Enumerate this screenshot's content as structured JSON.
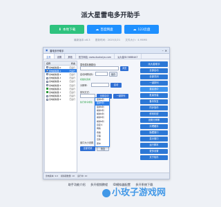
{
  "header": {
    "title": "派大星雷电多开助手"
  },
  "buttons": [
    {
      "label": "本地下载",
      "color": "#2ec27e"
    },
    {
      "label": "百度网盘",
      "color": "#1e90ff"
    },
    {
      "label": "123云盘",
      "color": "#1e90ff"
    }
  ],
  "meta": {
    "version": "最新版本:v8.3",
    "updated": "更新时间：2025/3/21",
    "size": "文件大小：4.95MB"
  },
  "window": {
    "title": "雷电多开助手",
    "tabs": [
      "主页",
      "设置",
      "其他",
      "官方网站: www.duokaiya.com",
      "派大星ID:56B84A7"
    ],
    "list_header": [
      "名称",
      "状态"
    ],
    "list": [
      {
        "name": "雷电模拟器-0",
        "val": "已运行"
      },
      {
        "name": "雷电模拟器-1",
        "val": "已运行"
      },
      {
        "name": "雷电模拟器-2",
        "val": "已运行"
      },
      {
        "name": "雷电模拟器-3",
        "val": "已运行"
      },
      {
        "name": "雷电模拟器-4",
        "val": "已运行"
      },
      {
        "name": "雷电模拟器-5",
        "val": "已运行"
      },
      {
        "name": "雷电模拟器-6",
        "val": "已运行"
      },
      {
        "name": "雷电模拟器-7",
        "val": "已运行"
      },
      {
        "name": "雷电模拟器-8",
        "val": "已运行"
      },
      {
        "name": "雷电模拟器-9",
        "val": "已运行"
      }
    ],
    "mid": {
      "l1": "雷电模拟器路径:",
      "l2": "启动间隔(秒):",
      "l3": "排列方式:",
      "l4": "分辨率:",
      "l5": "窗口大小设置",
      "b1": "浏览",
      "b2": "保存",
      "b3": "启动",
      "b4": "全部启动",
      "b5": "一键排列",
      "b6": "全部关闭",
      "b7": "恢复",
      "green1": "初始化完成",
      "green2": "执行命令成功"
    },
    "drop": [
      "竖排4列",
      "竖排5列",
      "竖排6列",
      "横排3列",
      "横排4列",
      "横排5列",
      "横排6列",
      "自定义",
      "网格",
      "叠放",
      "平铺",
      "层叠",
      "居中"
    ],
    "right": {
      "logo": "派大星助手",
      "buttons": [
        "全部启动",
        "全部关闭",
        "一键排列",
        "重启选中",
        "批量安装",
        "备份恢复",
        "同步操作",
        "修改机型",
        "设置分辨率",
        "清理缓存",
        "隐藏窗口",
        "显示窗口",
        "运行脚本",
        "更多设置",
        "关于软件"
      ]
    },
    "status": [
      "雷电版本: 9.0",
      "模拟器数量: 10",
      "运行中: 10"
    ]
  },
  "footer_links": [
    "助手功能介绍",
    "多开视频教程",
    "ID模拟器配置",
    "多开系统下载"
  ],
  "watermark": "小玫子游戏网"
}
